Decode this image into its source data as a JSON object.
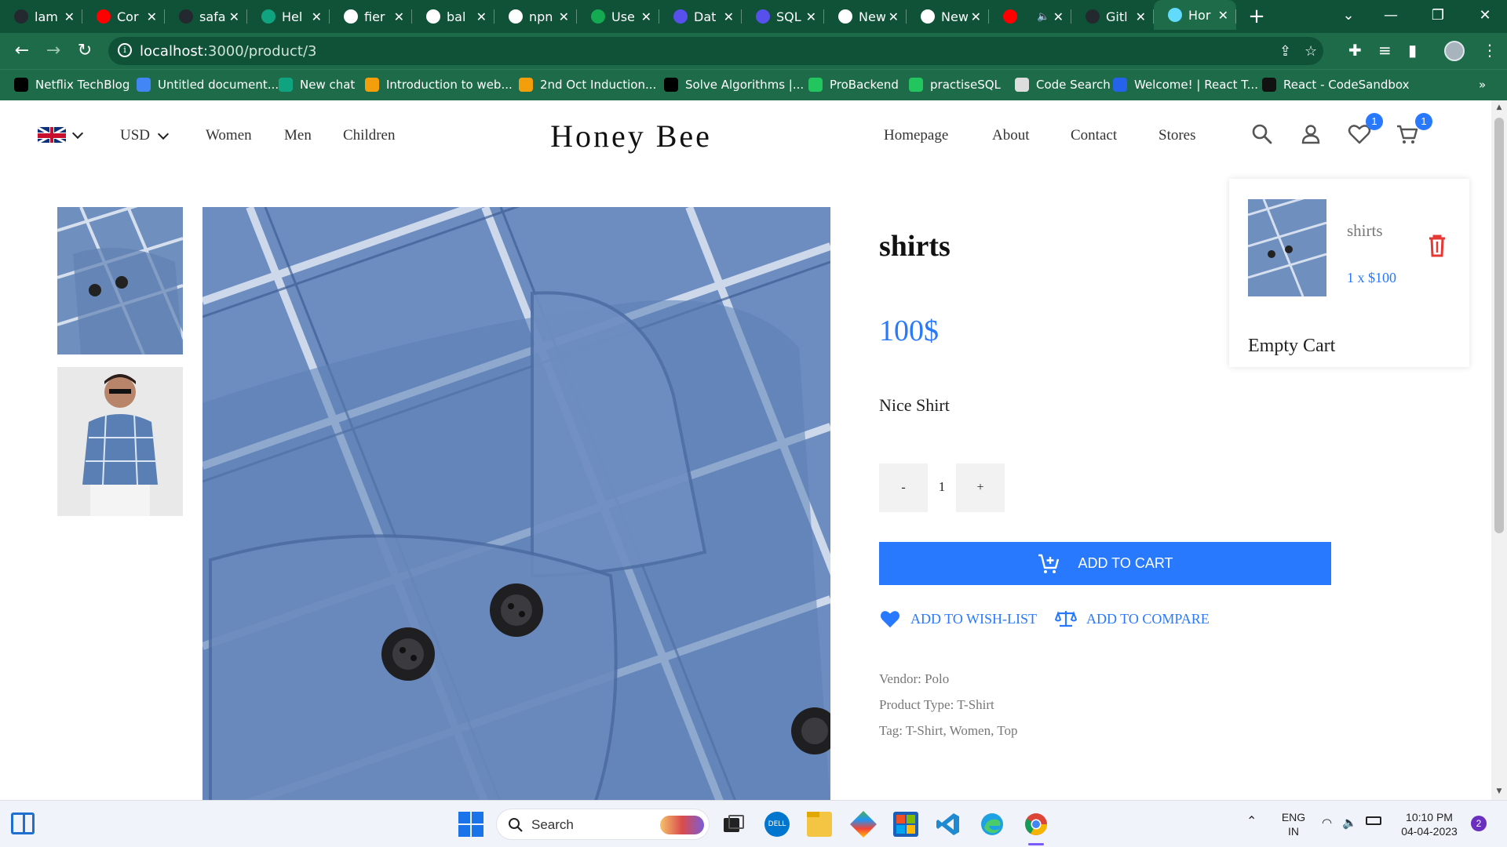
{
  "browser": {
    "tabs": [
      {
        "label": "lam",
        "icon": "github-icon",
        "color": "#24292f"
      },
      {
        "label": "Cor",
        "icon": "youtube-icon",
        "color": "#ff0000"
      },
      {
        "label": "safa",
        "icon": "github-icon",
        "color": "#24292f"
      },
      {
        "label": "Hel",
        "icon": "chatgpt-icon",
        "color": "#10a37f"
      },
      {
        "label": "fier",
        "icon": "github-mark-icon",
        "color": "#ffffff"
      },
      {
        "label": "bal",
        "icon": "google-icon",
        "color": "#ffffff"
      },
      {
        "label": "npn",
        "icon": "google-icon",
        "color": "#ffffff"
      },
      {
        "label": "Use",
        "icon": "mongodb-icon",
        "color": "#13aa52"
      },
      {
        "label": "Dat",
        "icon": "app-icon",
        "color": "#5850ec"
      },
      {
        "label": "SQL",
        "icon": "app-icon",
        "color": "#5850ec"
      },
      {
        "label": "New",
        "icon": "chrome-icon",
        "color": "#ffffff"
      },
      {
        "label": "New",
        "icon": "chrome-icon",
        "color": "#ffffff"
      },
      {
        "label": "",
        "icon": "youtube-icon",
        "color": "#ff0000",
        "audio": "🔈"
      },
      {
        "label": "Gitl",
        "icon": "github-icon",
        "color": "#24292f"
      },
      {
        "label": "Hor",
        "icon": "react-icon",
        "color": "#61dafb",
        "active": true
      }
    ],
    "close_glyph": "✕",
    "new_tab_glyph": "+",
    "url_host": "localhost",
    "url_path": ":3000/product/3",
    "bookmarks": [
      {
        "label": "Netflix TechBlog",
        "color": "#000000"
      },
      {
        "label": "Untitled document...",
        "color": "#4285f4"
      },
      {
        "label": "New chat",
        "color": "#10a37f"
      },
      {
        "label": "Introduction to web...",
        "color": "#f59e0b"
      },
      {
        "label": "2nd Oct Induction...",
        "color": "#f59e0b"
      },
      {
        "label": "Solve Algorithms |...",
        "color": "#000000"
      },
      {
        "label": "ProBackend",
        "color": "#22c55e"
      },
      {
        "label": "practiseSQL",
        "color": "#22c55e"
      },
      {
        "label": "Code Search",
        "color": "#dddddd"
      },
      {
        "label": "Welcome! | React T...",
        "color": "#2563eb"
      },
      {
        "label": "React - CodeSandbox",
        "color": "#111111"
      }
    ],
    "bookmarks_more": "»"
  },
  "header": {
    "currency": "USD",
    "left_links": [
      "Women",
      "Men",
      "Children"
    ],
    "logo": "Honey Bee",
    "right_links": [
      "Homepage",
      "About",
      "Contact",
      "Stores"
    ],
    "wishlist_count": "1",
    "cart_count": "1"
  },
  "product": {
    "title": "shirts",
    "price": "100$",
    "description": "Nice Shirt",
    "quantity": "1",
    "minus": "-",
    "plus": "+",
    "add_to_cart": "ADD TO CART",
    "add_to_wishlist": "ADD TO WISH-LIST",
    "add_to_compare": "ADD TO COMPARE",
    "vendor": "Vendor: Polo",
    "product_type": "Product Type: T-Shirt",
    "tags": "Tag: T-Shirt, Women, Top"
  },
  "cart_popup": {
    "item_name": "shirts",
    "item_qty_price": "1 x $100",
    "empty_label": "Empty Cart"
  },
  "colors": {
    "accent": "#2879fe",
    "delete": "#e53935",
    "chrome_dark": "#0f5237",
    "chrome_light": "#1d6b48"
  },
  "taskbar": {
    "search_placeholder": "Search",
    "lang_line1": "ENG",
    "lang_line2": "IN",
    "time": "10:10 PM",
    "date": "04-04-2023",
    "notifications": "2"
  }
}
